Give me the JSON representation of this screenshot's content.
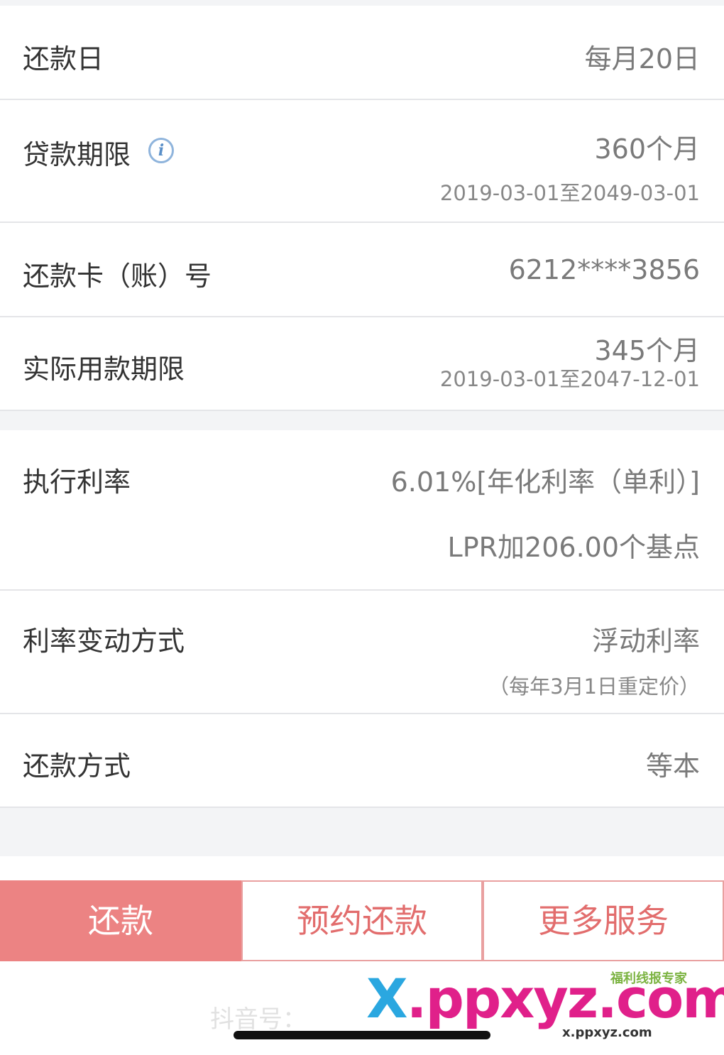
{
  "loan": {
    "repay_day": {
      "label": "还款日",
      "value": "每月20日"
    },
    "term": {
      "label": "贷款期限",
      "value": "360个月",
      "range": "2019-03-01至2049-03-01"
    },
    "card": {
      "label": "还款卡（账）号",
      "value": "6212****3856"
    },
    "actual_term": {
      "label": "实际用款期限",
      "value": "345个月",
      "range": "2019-03-01至2047-12-01"
    }
  },
  "rate": {
    "exec_rate": {
      "label": "执行利率",
      "value": "6.01%[年化利率（单利）]",
      "lpr": "LPR加206.00个基点"
    },
    "change_method": {
      "label": "利率变动方式",
      "value": "浮动利率",
      "note": "（每年3月1日重定价）"
    },
    "repay_method": {
      "label": "还款方式",
      "value": "等本"
    }
  },
  "actions": {
    "repay": "还款",
    "schedule_repay": "预约还款",
    "more_services": "更多服务"
  },
  "watermark": {
    "tiktok": "抖音号：",
    "logo_top": "福利线报专家",
    "logo_x": "X",
    "logo_rest": ".ppxyz.com",
    "logo_sub": "x.ppxyz.com"
  },
  "colors": {
    "primary": "#ec8383",
    "outline_text": "#e26d6d",
    "info_icon": "#5a8fc8"
  },
  "icons": {
    "term_info": "info-icon"
  }
}
